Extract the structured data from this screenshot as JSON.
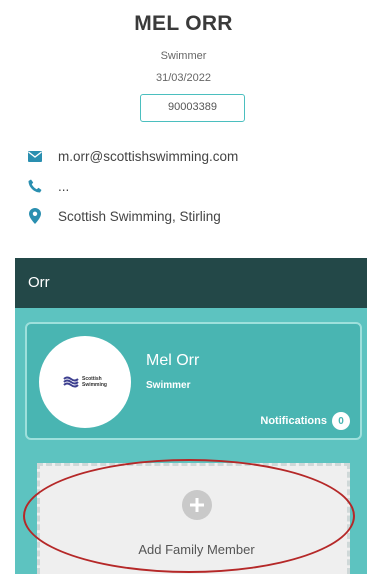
{
  "profile": {
    "name": "MEL ORR",
    "role": "Swimmer",
    "date": "31/03/2022",
    "member_id": "90003389"
  },
  "contact": {
    "email": "m.orr@scottishswimming.com",
    "phone": "...",
    "location": "Scottish Swimming, Stirling",
    "icons": {
      "email": "envelope-icon",
      "phone": "phone-icon",
      "location": "map-pin-icon"
    }
  },
  "panel": {
    "title": "Orr",
    "card": {
      "name": "Mel Orr",
      "role": "Swimmer",
      "logo_text_1": "Scottish",
      "logo_text_2": "Swimming",
      "notifications_label": "Notifications",
      "notifications_count": "0"
    },
    "add_member_label": "Add Family Member"
  },
  "colors": {
    "accent": "#4bbfbf",
    "panel_bg": "#5dc3c0",
    "panel_header": "#234848",
    "card_bg": "#49b5b2",
    "annotation": "#b52828"
  }
}
